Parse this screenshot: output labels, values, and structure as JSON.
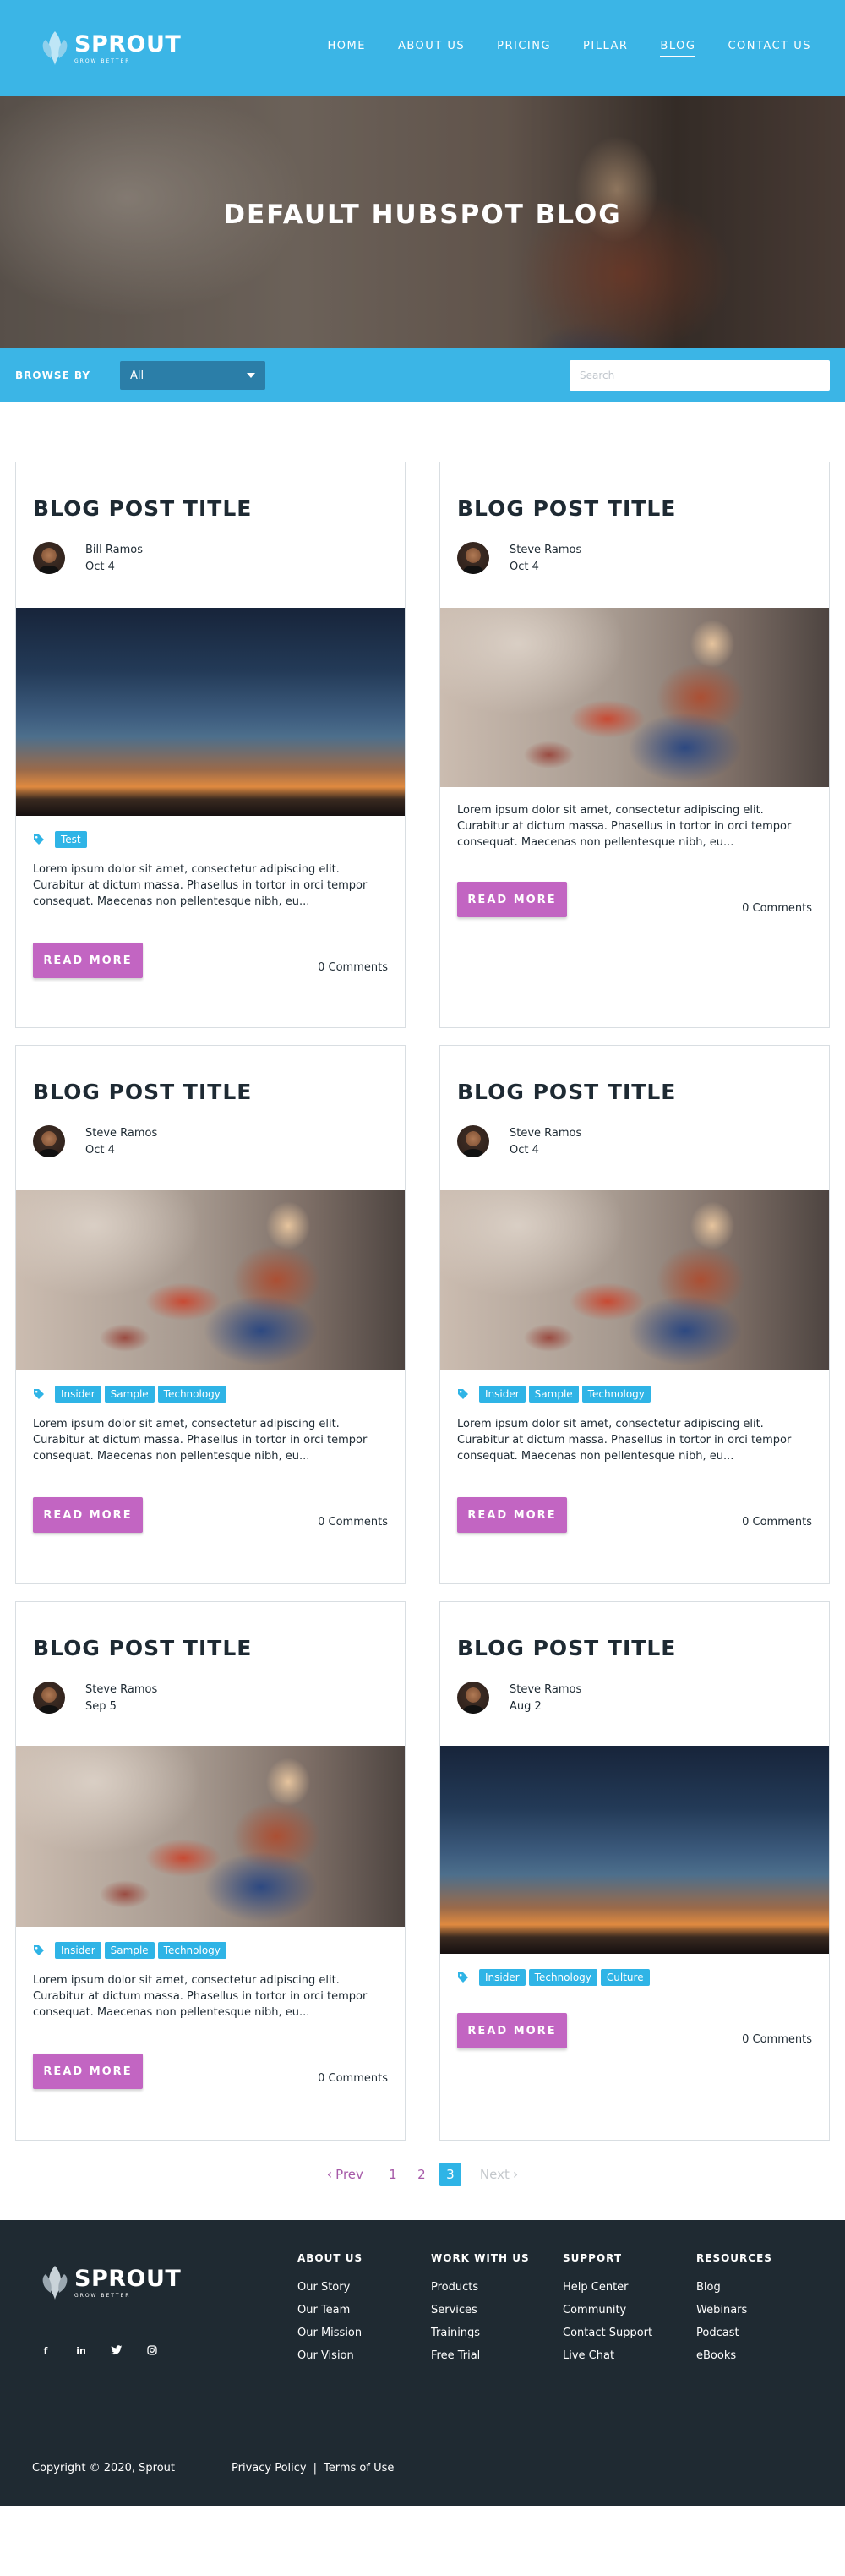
{
  "brand": {
    "name": "SPROUT",
    "tagline": "GROW BETTER"
  },
  "nav": [
    {
      "label": "HOME"
    },
    {
      "label": "ABOUT US"
    },
    {
      "label": "PRICING"
    },
    {
      "label": "PILLAR"
    },
    {
      "label": "BLOG",
      "active": true
    },
    {
      "label": "CONTACT US"
    }
  ],
  "hero": {
    "title": "DEFAULT HUBSPOT BLOG"
  },
  "filter": {
    "label": "BROWSE BY",
    "selected": "All",
    "search_placeholder": "Search"
  },
  "excerpt_text": "Lorem ipsum dolor sit amet, consectetur adipiscing elit. Curabitur at dictum massa. Phasellus in tortor in orci tempor consequat. Maecenas non pellentesque nibh, eu...",
  "posts": [
    {
      "title": "BLOG POST TITLE",
      "author": "Bill Ramos",
      "date": "Oct 4",
      "image": "sunset-city",
      "tags": [
        "Test"
      ],
      "excerpt": "Lorem ipsum dolor sit amet, consectetur adipiscing elit. Curabitur at dictum massa. Phasellus in tortor in orci tempor consequat. Maecenas non pellentesque nibh, eu...",
      "read_more": "READ MORE",
      "comments": "0 Comments"
    },
    {
      "title": "BLOG POST TITLE",
      "author": "Steve Ramos",
      "date": "Oct 4",
      "image": "woman-office",
      "tags": [],
      "excerpt": "Lorem ipsum dolor sit amet, consectetur adipiscing elit. Curabitur at dictum massa. Phasellus in tortor in orci tempor consequat. Maecenas non pellentesque nibh, eu...",
      "read_more": "READ MORE",
      "comments": "0 Comments"
    },
    {
      "title": "BLOG POST TITLE",
      "author": "Steve Ramos",
      "date": "Oct 4",
      "image": "woman-office",
      "tags": [
        "Insider",
        "Sample",
        "Technology"
      ],
      "excerpt": "Lorem ipsum dolor sit amet, consectetur adipiscing elit. Curabitur at dictum massa. Phasellus in tortor in orci tempor consequat. Maecenas non pellentesque nibh, eu...",
      "read_more": "READ MORE",
      "comments": "0 Comments"
    },
    {
      "title": "BLOG POST TITLE",
      "author": "Steve Ramos",
      "date": "Oct 4",
      "image": "woman-office",
      "tags": [
        "Insider",
        "Sample",
        "Technology"
      ],
      "excerpt": "Lorem ipsum dolor sit amet, consectetur adipiscing elit. Curabitur at dictum massa. Phasellus in tortor in orci tempor consequat. Maecenas non pellentesque nibh, eu...",
      "read_more": "READ MORE",
      "comments": "0 Comments"
    },
    {
      "title": "BLOG POST TITLE",
      "author": "Steve Ramos",
      "date": "Sep 5",
      "image": "woman-office",
      "tags": [
        "Insider",
        "Sample",
        "Technology"
      ],
      "excerpt": "Lorem ipsum dolor sit amet, consectetur adipiscing elit. Curabitur at dictum massa. Phasellus in tortor in orci tempor consequat. Maecenas non pellentesque nibh, eu...",
      "read_more": "READ MORE",
      "comments": "0 Comments"
    },
    {
      "title": "BLOG POST TITLE",
      "author": "Steve Ramos",
      "date": "Aug 2",
      "image": "sunset-city",
      "tags": [
        "Insider",
        "Technology",
        "Culture"
      ],
      "excerpt": "",
      "read_more": "READ MORE",
      "comments": "0 Comments"
    }
  ],
  "pagination": {
    "prev": "Prev",
    "pages": [
      "1",
      "2",
      "3"
    ],
    "current": "3",
    "next": "Next"
  },
  "footer": {
    "socials": [
      "facebook-icon",
      "linkedin-icon",
      "twitter-icon",
      "instagram-icon"
    ],
    "columns": [
      {
        "heading": "ABOUT US",
        "links": [
          "Our Story",
          "Our Team",
          "Our Mission",
          "Our Vision"
        ]
      },
      {
        "heading": "WORK WITH US",
        "links": [
          "Products",
          "Services",
          "Trainings",
          "Free Trial"
        ]
      },
      {
        "heading": "SUPPORT",
        "links": [
          "Help Center",
          "Community",
          "Contact Support",
          "Live Chat"
        ]
      },
      {
        "heading": "RESOURCES",
        "links": [
          "Blog",
          "Webinars",
          "Podcast",
          "eBooks"
        ]
      }
    ],
    "copyright": "Copyright © 2020, Sprout",
    "privacy": "Privacy Policy",
    "separator": "|",
    "terms": "Terms of Use"
  },
  "colors": {
    "primary": "#3bb5e6",
    "accent": "#c265c2",
    "tag": "#2fb4e6",
    "footer": "#1f2a32",
    "pagination_link": "#a65aa8"
  }
}
